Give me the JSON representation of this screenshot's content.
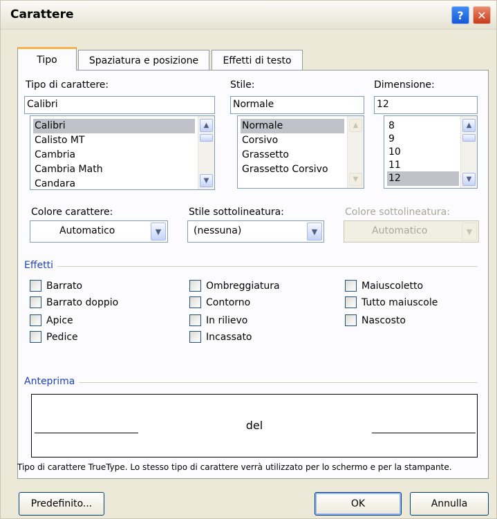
{
  "window": {
    "title": "Carattere"
  },
  "titlebar": {
    "help_glyph": "?",
    "close_glyph": "✕"
  },
  "tabs": [
    {
      "label": "Tipo",
      "mnemonic_index": 0
    },
    {
      "label": "Spaziatura e posizione"
    },
    {
      "label": "Effetti di testo"
    }
  ],
  "font": {
    "label": "Tipo di carattere:",
    "value": "Calibri",
    "items": [
      "Calibri",
      "Calisto MT",
      "Cambria",
      "Cambria Math",
      "Candara"
    ],
    "selected_index": 0
  },
  "style": {
    "label": "Stile:",
    "value": "Normale",
    "items": [
      "Normale",
      "Corsivo",
      "Grassetto",
      "Grassetto Corsivo"
    ],
    "selected_index": 0
  },
  "size": {
    "label": "Dimensione:",
    "value": "12",
    "items": [
      "8",
      "9",
      "10",
      "11",
      "12"
    ],
    "selected_index": 4
  },
  "color": {
    "label": "Colore carattere:",
    "value": "Automatico"
  },
  "underline_style": {
    "label": "Stile sottolineatura:",
    "value": "(nessuna)"
  },
  "underline_color": {
    "label": "Colore sottolineatura:",
    "value": "Automatico",
    "disabled": true
  },
  "effects": {
    "title": "Effetti",
    "col1": [
      "Barrato",
      "Barrato doppio",
      "Apice",
      "Pedice"
    ],
    "col2": [
      "Ombreggiatura",
      "Contorno",
      "In rilievo",
      "Incassato"
    ],
    "col3": [
      "Maiuscoletto",
      "Tutto maiuscole",
      "Nascosto"
    ]
  },
  "preview": {
    "title": "Anteprima",
    "sample_text": "del",
    "note": "Tipo di carattere TrueType. Lo stesso tipo di carattere verrà utilizzato per lo schermo e per la stampante."
  },
  "buttons": {
    "default": "Predefinito...",
    "ok": "OK",
    "cancel": "Annulla"
  }
}
